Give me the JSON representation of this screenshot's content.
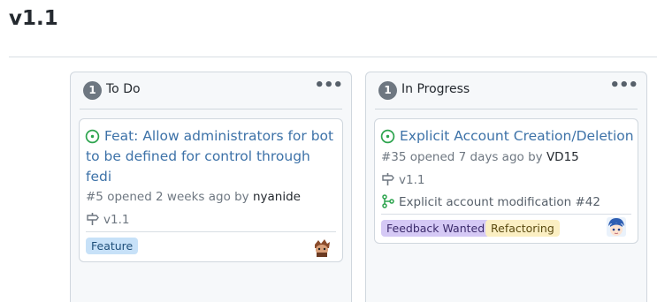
{
  "page": {
    "title": "v1.1"
  },
  "columns": [
    {
      "count": "1",
      "name": "To Do",
      "menu": "•••",
      "card": {
        "title": "Feat: Allow administrators for bot to be defined for control through fedi",
        "meta_prefix": "#5 opened 2 weeks ago by",
        "author": "nyanide",
        "milestone": "v1.1",
        "labels": [
          {
            "text": "Feature",
            "bg": "#c7e1f8",
            "fg": "#1f4f7a"
          }
        ]
      }
    },
    {
      "count": "1",
      "name": "In Progress",
      "menu": "•••",
      "card": {
        "title": "Explicit Account Creation/Deletion",
        "meta_prefix": "#35 opened 7 days ago by",
        "author": "VD15",
        "milestone": "v1.1",
        "linked_pr": "Explicit account modification #42",
        "labels": [
          {
            "text": "Feedback Wanted",
            "bg": "#d5c9f5",
            "fg": "#3b2a6b"
          },
          {
            "text": "Refactoring",
            "bg": "#fbefc3",
            "fg": "#5a4a10"
          }
        ]
      }
    }
  ],
  "colors": {
    "open_issue": "#2da44e",
    "link": "#3d72a8",
    "muted": "#6e7781"
  },
  "icons": [
    "issue-open-icon",
    "milestone-icon",
    "pull-request-icon",
    "kebab-menu-icon"
  ]
}
